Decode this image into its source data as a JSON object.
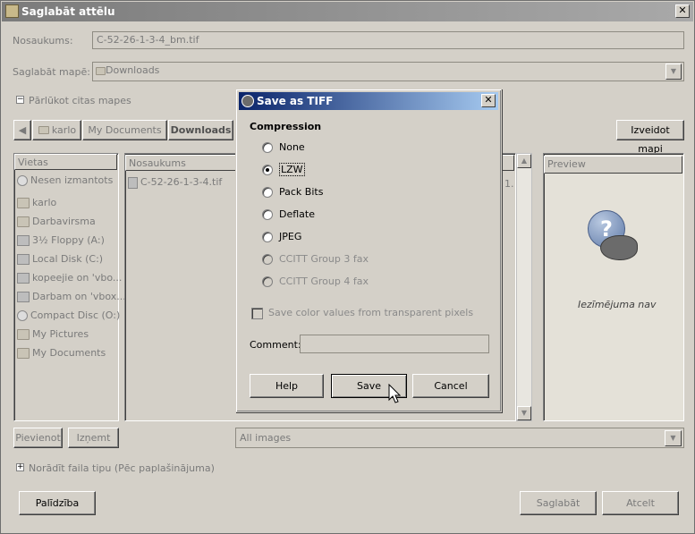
{
  "window": {
    "title": "Saglabāt attēlu",
    "close": "✕"
  },
  "form": {
    "name_label": "Nosaukums:",
    "name_value": "C-52-26-1-3-4_bm.tif",
    "folder_label": "Saglabāt mapē:",
    "folder_value": "Downloads",
    "browse_toggle": "Pārlūkot citas mapes"
  },
  "path_bar": {
    "back": "◀",
    "items": [
      "karlo",
      "My Documents",
      "Downloads"
    ],
    "create_folder": "Izveidot mapi"
  },
  "places": {
    "header": "Vietas",
    "items": [
      "Nesen izmantots",
      "karlo",
      "Darbavirsma",
      "3½ Floppy (A:)",
      "Local Disk (C:)",
      "kopeejie on 'vbo...",
      "Darbam on 'vbox...",
      "Compact Disc (O:)",
      "My Pictures",
      "My Documents"
    ],
    "add": "Pievienot",
    "remove": "Izņemt"
  },
  "files": {
    "header": "Nosaukums",
    "items": [
      "C-52-26-1-3-4.tif"
    ],
    "clipped_text": "1."
  },
  "preview": {
    "header": "Preview",
    "no_selection": "Iezīmējuma nav"
  },
  "filter": {
    "value": "All images"
  },
  "file_type_toggle": "Norādīt faila tipu (Pēc paplašinājuma)",
  "buttons": {
    "help": "Palīdzība",
    "save": "Saglabāt",
    "cancel": "Atcelt"
  },
  "dialog": {
    "title": "Save as TIFF",
    "close": "✕",
    "section": "Compression",
    "options": [
      "None",
      "LZW",
      "Pack Bits",
      "Deflate",
      "JPEG",
      "CCITT Group 3 fax",
      "CCITT Group 4 fax"
    ],
    "selected": "LZW",
    "checkbox_label": "Save color values from transparent pixels",
    "comment_label": "Comment:",
    "comment_value": "",
    "help": "Help",
    "save": "Save",
    "cancel": "Cancel"
  }
}
